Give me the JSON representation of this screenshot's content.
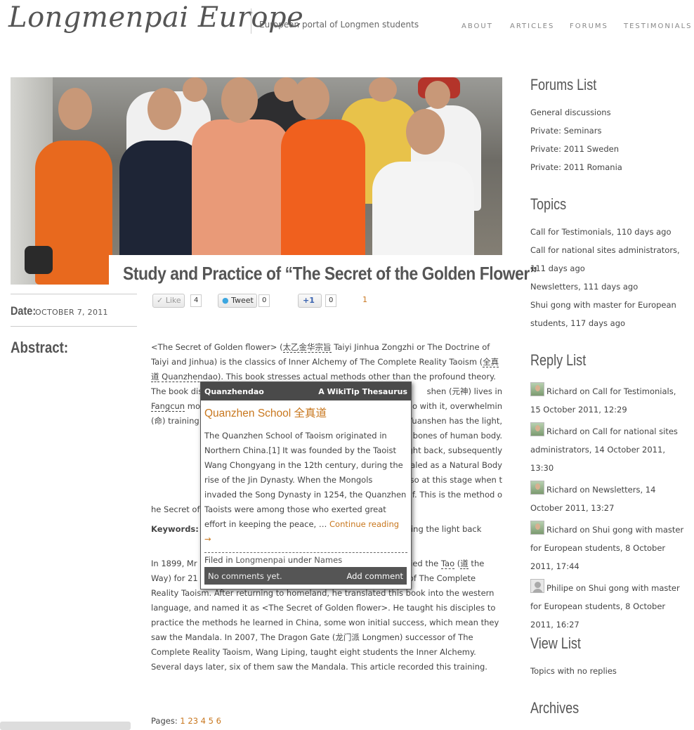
{
  "site": {
    "title": "Longmenpai Europe",
    "tagline": "European portal of Longmen students"
  },
  "nav": [
    "ABOUT",
    "ARTICLES",
    "FORUMS",
    "TESTIMONIALS"
  ],
  "post": {
    "title": "Study and Practice of “The Secret of the Golden Flower”",
    "date_label": "Date:",
    "date": "OCTOBER 7, 2011",
    "abstract_label": "Abstract:",
    "social": {
      "like_label": "Like",
      "like_count": "4",
      "tweet_label": "Tweet",
      "tweet_count": "0",
      "plusone_label": "+1",
      "plusone_count": "0",
      "rating": "1"
    },
    "p1_a": "<The Secret of Golden flower> (",
    "p1_cn1": "太乙金华宗旨",
    "p1_b": " Taiyi Jinhua Zongzhi or The Doctrine of Taiyi and Jinhua) is the classics of Inner Alchemy of The Complete Reality Taoism (",
    "p1_cn2": "全真道",
    "p1_c": " ",
    "p1_link": "Quanzhendao",
    "p1_d": "). This book stresses actual methods other than the profound theory. The book disclos",
    "p1_e": "shen (元神) lives in",
    "p1_f": "Fangcun",
    "p1_g": " mot",
    "p1_h": "g to do with it, overwhelmin",
    "p1_i": "(命) training or the cultivating of",
    "p1_j": "hen. The Yuanshen has the light,",
    "p1_k": "limbs and bones of human body.",
    "p1_l": "to turn the light back, subsequently",
    "p1_m": "s congealed as a Natural Body",
    "p1_n": "ctive. It is also at this stage when t",
    "p1_o": "re) of himself. This is the method o",
    "p1_p": "he Secret of Golden flower> gives",
    "kw_label": "Keywords:",
    "kw_rest": "shen (元神), Turning the light back",
    "p3_a": "In 1899, Mr Richard Wilhelm from Germany came to China, studied the ",
    "p3_tao": "Tao",
    "p3_b": " (",
    "p3_cn": "道",
    "p3_c": " the Way) for 21 years. He got this book and learned Inner Alchemy of The Complete Reality Taoism. After returning to homeland, he translated this book into the western language, and named it as <The Secret of Golden flower>. He taught his disciples to practice the methods he learned in China, some won initial success, which mean they saw the Mandala. In 2007, The Dragon Gate (龙门派 Longmen) successor of The Complete Reality Taoism, Wang Liping, taught eight students the Inner Alchemy. Several days later, six of them saw the Mandala. This article recorded this training.",
    "pages_label": "Pages:",
    "pages": [
      "1",
      "2",
      "3",
      "4",
      "5",
      "6"
    ]
  },
  "tooltip": {
    "header_left": "Quanzhendao",
    "header_right": "A WikiTip Thesaurus",
    "title": "Quanzhen School 全真道",
    "body": "The Quanzhen School of Taoism originated in Northern China.[1] It was founded by the Taoist Wang Chongyang in the 12th century, during the rise of the Jin Dynasty. When the Mongols invaded the Song Dynasty in 1254, the Quanzhen Taoists were among those who exerted great effort in keeping the peace, … ",
    "continue": "Continue reading →",
    "filed_a": "Filed in ",
    "filed_link1": "Longmenpai",
    "filed_b": " under ",
    "filed_link2": "Names",
    "no_comments": "No comments yet.",
    "add_comment": "Add comment"
  },
  "sidebar": {
    "forums_heading": "Forums List",
    "forums": [
      "General discussions",
      "Private: Seminars",
      "Private: 2011 Sweden",
      "Private: 2011 Romania"
    ],
    "topics_heading": "Topics",
    "topics": [
      "Call for Testimonials, 110 days ago",
      "Call for national sites administrators, 111 days ago",
      "Newsletters, 111 days ago",
      "Shui gong with master for European students, 117 days ago"
    ],
    "reply_heading": "Reply List",
    "replies": [
      "Richard on Call for Testimonials, 15 October 2011, 12:29",
      "Richard on Call for national sites administrators, 14 October 2011, 13:30",
      "Richard on Newsletters, 14 October 2011, 13:27",
      "Richard on Shui gong with master for European students, 8 October 2011, 17:44",
      "Philipe on Shui gong with master for European students, 8 October 2011, 16:27"
    ],
    "view_heading": "View List",
    "views": [
      "Topics with no replies"
    ],
    "archives_heading": "Archives"
  }
}
